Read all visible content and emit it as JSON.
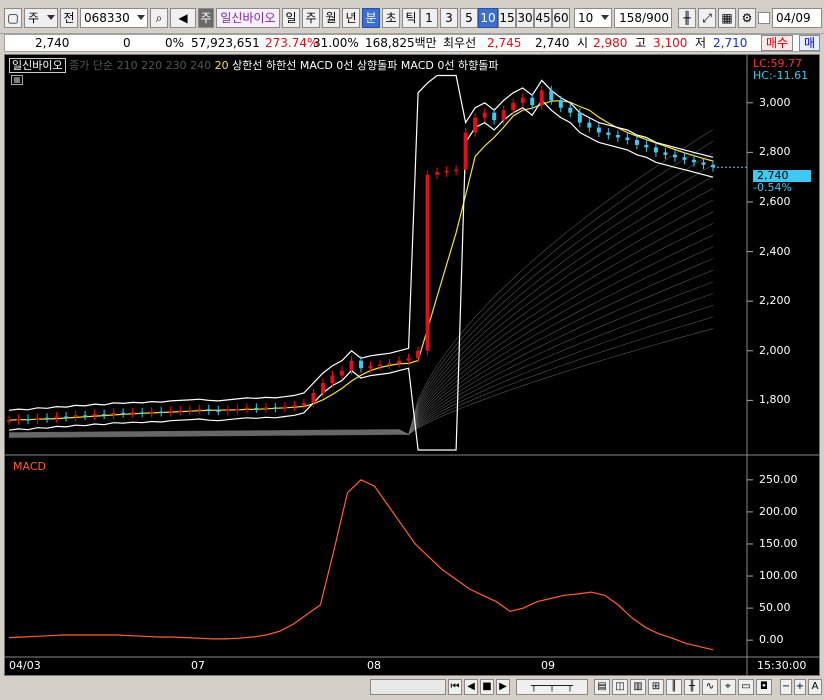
{
  "toolbar": {
    "mode_label": "주",
    "type_label": "전",
    "code": "068330",
    "badge": "주",
    "stock_name": "일신바이오",
    "periods": [
      "일",
      "주",
      "월",
      "년",
      "분",
      "초",
      "틱"
    ],
    "intervals": [
      "1",
      "3",
      "5",
      "10",
      "15",
      "30",
      "45",
      "60"
    ],
    "active_interval": "10",
    "interval_select": "10",
    "count": "158",
    "count_total": "/900",
    "date": "04/09"
  },
  "quote": {
    "price": "2,740",
    "change": "0",
    "change_pct": "0%",
    "volume": "57,923,651",
    "vol_ratio": "273.74%",
    "turnover": "31.00%",
    "amount": "168,825백만",
    "best_label": "최우선",
    "best_ask": "2,745",
    "best_bid": "2,740",
    "open_label": "시",
    "open": "2,980",
    "high_label": "고",
    "high": "3,100",
    "low_label": "저",
    "low": "2,710",
    "buy_label": "매수",
    "sell_label": "매"
  },
  "legend": {
    "name": "일신바이오",
    "series1": "종가 단순 210",
    "series2": "220",
    "series3": "230",
    "series4": "240",
    "series5": "20",
    "series6": "상한선",
    "series7": "하한선",
    "series8": "MACD 0선 상향돌파",
    "series9": "MACD 0선 하향돌파"
  },
  "readouts": {
    "lc": "LC:59.77",
    "hc": "HC:-11.61",
    "current_price": "2,740",
    "current_pct": "-0.54%"
  },
  "macd_label": "MACD",
  "time_label": "15:30:00",
  "colors": {
    "up": "#e0101a",
    "down": "#40c8f0",
    "ma20": "#f0e040",
    "band": "#ffffff",
    "macd": "#ff6030",
    "background": "#000000"
  },
  "chart_data": [
    {
      "type": "candlestick",
      "title": "",
      "x_ticks": [
        "04/03",
        "07",
        "08",
        "09"
      ],
      "y_ticks": [
        1800,
        2000,
        2200,
        2400,
        2600,
        2800,
        3000
      ],
      "ylim": [
        1600,
        3120
      ],
      "last_price": 2740,
      "series": [
        {
          "name": "20",
          "color": "#f0e040"
        },
        {
          "name": "상한선",
          "color": "#ffffff"
        },
        {
          "name": "하한선",
          "color": "#ffffff"
        }
      ],
      "closes": [
        1720,
        1725,
        1722,
        1730,
        1728,
        1735,
        1733,
        1740,
        1738,
        1745,
        1742,
        1750,
        1748,
        1752,
        1750,
        1755,
        1753,
        1758,
        1760,
        1762,
        1765,
        1760,
        1758,
        1762,
        1766,
        1770,
        1768,
        1772,
        1770,
        1775,
        1780,
        1790,
        1830,
        1870,
        1900,
        1920,
        1960,
        1930,
        1940,
        1945,
        1950,
        1960,
        1970,
        2000,
        2710,
        2720,
        2725,
        2730,
        2880,
        2940,
        2960,
        2930,
        2970,
        3000,
        3020,
        2990,
        3050,
        3010,
        2980,
        2960,
        2920,
        2900,
        2880,
        2870,
        2860,
        2850,
        2830,
        2820,
        2800,
        2790,
        2780,
        2770,
        2760,
        2750,
        2740
      ]
    },
    {
      "type": "line",
      "title": "MACD",
      "y_ticks": [
        0,
        50,
        100,
        150,
        200,
        250
      ],
      "ylim": [
        -20,
        270
      ],
      "values": [
        4,
        5,
        6,
        7,
        8,
        8,
        8,
        8,
        8,
        7,
        6,
        5,
        5,
        4,
        3,
        2,
        2,
        3,
        5,
        8,
        14,
        25,
        40,
        55,
        140,
        230,
        250,
        240,
        210,
        180,
        150,
        130,
        110,
        95,
        80,
        70,
        60,
        45,
        50,
        60,
        65,
        70,
        72,
        75,
        70,
        55,
        35,
        20,
        10,
        3,
        -5,
        -10,
        -15
      ]
    }
  ]
}
